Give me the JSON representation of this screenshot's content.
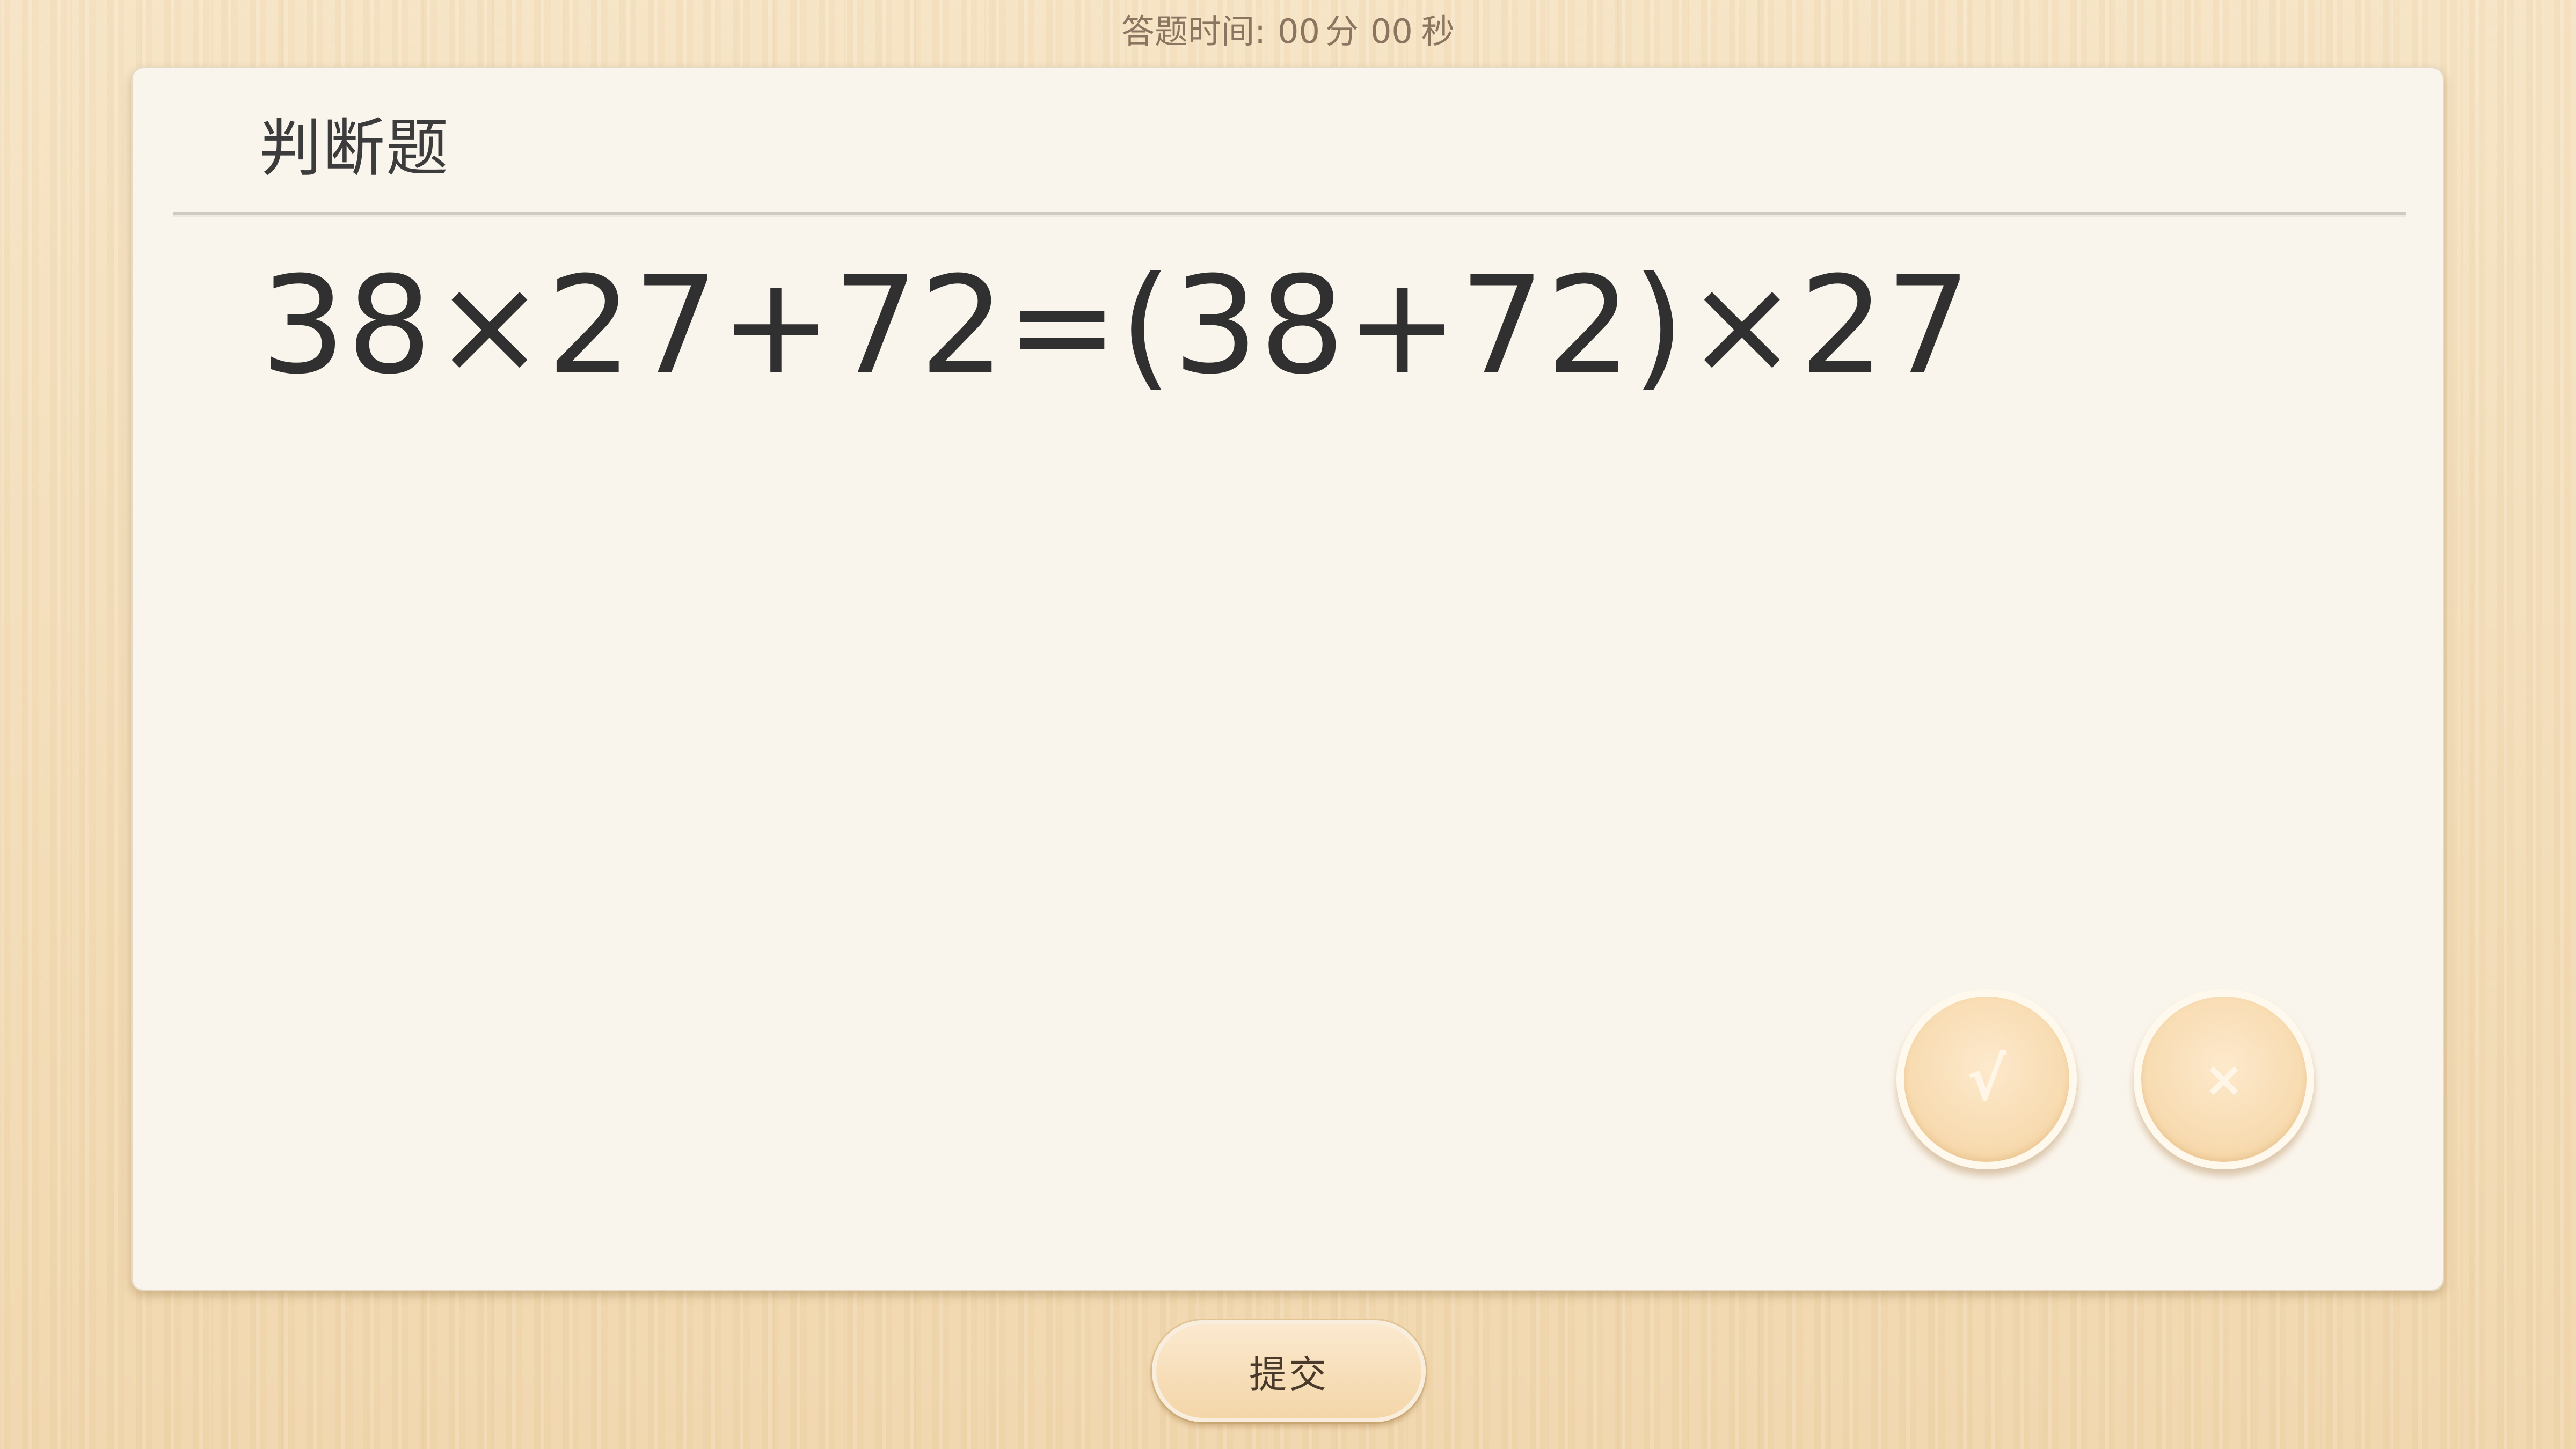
{
  "timer": {
    "label": "答题时间:",
    "minutes": "00",
    "minutes_unit": "分",
    "seconds": "00",
    "seconds_unit": "秒"
  },
  "question": {
    "type_label": "判断题",
    "text": "38×27+72=(38+72)×27"
  },
  "options": {
    "true_label": "√",
    "false_label": "×"
  },
  "actions": {
    "submit_label": "提交"
  }
}
